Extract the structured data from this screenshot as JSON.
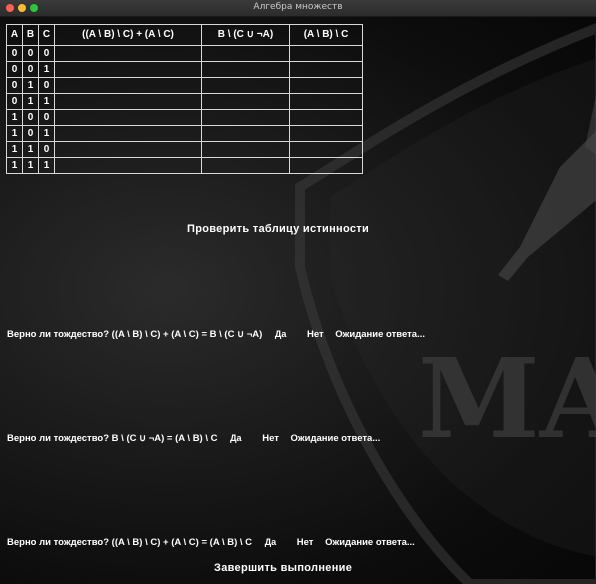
{
  "window": {
    "title": "Алгебра множеств"
  },
  "table": {
    "headers": [
      "A",
      "B",
      "C",
      "((A \\ B) \\ C) + (A \\ C)",
      "B \\ (C ∪ ¬A)",
      "(A \\ B) \\ C"
    ],
    "rows": [
      [
        "0",
        "0",
        "0",
        "",
        "",
        ""
      ],
      [
        "0",
        "0",
        "1",
        "",
        "",
        ""
      ],
      [
        "0",
        "1",
        "0",
        "",
        "",
        ""
      ],
      [
        "0",
        "1",
        "1",
        "",
        "",
        ""
      ],
      [
        "1",
        "0",
        "0",
        "",
        "",
        ""
      ],
      [
        "1",
        "0",
        "1",
        "",
        "",
        ""
      ],
      [
        "1",
        "1",
        "0",
        "",
        "",
        ""
      ],
      [
        "1",
        "1",
        "1",
        "",
        "",
        ""
      ]
    ]
  },
  "check_button": "Проверить таблицу истинности",
  "questions": [
    {
      "text": "Верно ли тождество? ((A \\ B) \\ C) + (A \\ C) = B \\ (C ∪ ¬A)",
      "yes": "Да",
      "no": "Нет",
      "status": "Ожидание ответа..."
    },
    {
      "text": "Верно ли тождество? B \\ (C ∪ ¬A) = (A \\ B) \\ C",
      "yes": "Да",
      "no": "Нет",
      "status": "Ожидание ответа..."
    },
    {
      "text": "Верно ли тождество? ((A \\ B) \\ C) + (A \\ C) = (A \\ B) \\ C",
      "yes": "Да",
      "no": "Нет",
      "status": "Ожидание ответа..."
    }
  ],
  "finish_button": "Завершить выполнение",
  "background": {
    "emblem_letters": "MA"
  }
}
